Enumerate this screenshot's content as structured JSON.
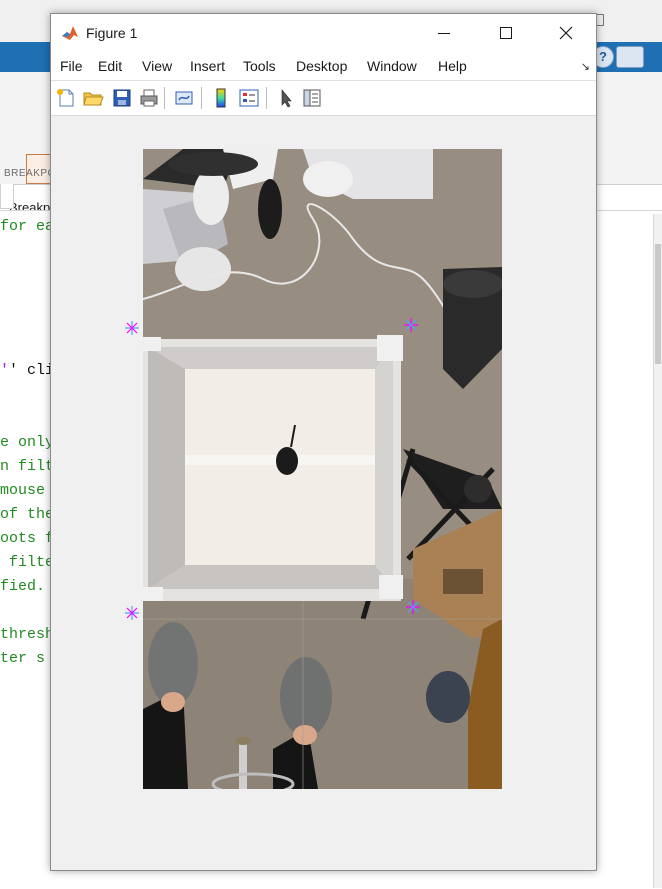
{
  "background": {
    "section_label": "BREAKPO",
    "breakpoints_label": "Breakp",
    "code_lines": [
      {
        "text": "for ea",
        "kind": "comment"
      },
      {
        "pre": "'",
        "text": "' cli",
        "kind": "mixed"
      },
      {
        "text": "e only",
        "kind": "comment"
      },
      {
        "text": "n filt",
        "kind": "comment"
      },
      {
        "text": "mouse",
        "kind": "comment"
      },
      {
        "text": "of the",
        "kind": "comment"
      },
      {
        "text": "oots f",
        "kind": "comment"
      },
      {
        "text": " filte",
        "kind": "comment"
      },
      {
        "text": "fied.",
        "kind": "comment"
      },
      {
        "text": "thresh",
        "kind": "comment"
      },
      {
        "text": "ter s",
        "kind": "comment"
      }
    ],
    "help_icon": "?"
  },
  "figure": {
    "title": "Figure 1",
    "logo_icon": "matlab-logo-icon",
    "window_buttons": [
      {
        "name": "minimize-button",
        "glyph": "—"
      },
      {
        "name": "maximize-button",
        "glyph": "☐"
      },
      {
        "name": "close-button",
        "glyph": "✕"
      }
    ],
    "menu": [
      "File",
      "Edit",
      "View",
      "Insert",
      "Tools",
      "Desktop",
      "Window",
      "Help"
    ],
    "menu_dock_glyph": "↘",
    "toolbar": [
      {
        "name": "new-figure-icon"
      },
      {
        "name": "open-file-icon"
      },
      {
        "name": "save-icon"
      },
      {
        "name": "print-icon"
      },
      {
        "name": "link-plot-icon"
      },
      {
        "name": "insert-colorbar-icon"
      },
      {
        "name": "insert-legend-icon"
      },
      {
        "name": "edit-plot-icon"
      },
      {
        "name": "property-inspector-icon"
      }
    ],
    "marker_color_a": "#ff00ff",
    "marker_color_b": "#4ea3ff"
  }
}
